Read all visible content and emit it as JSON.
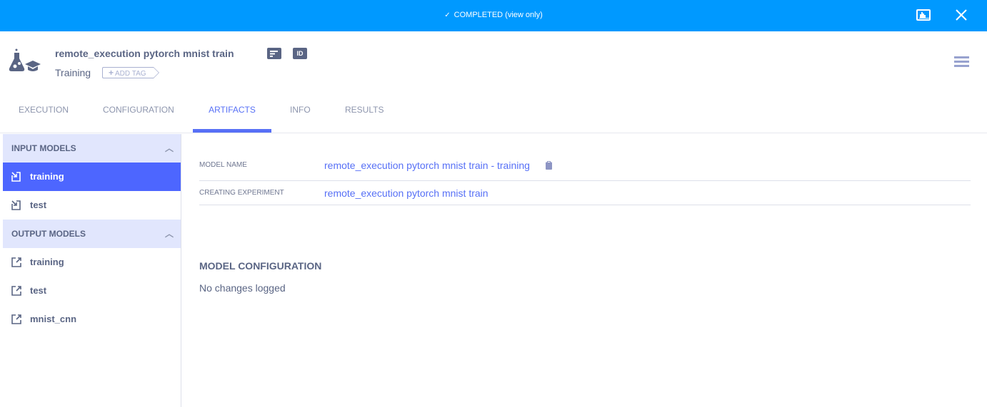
{
  "topbar": {
    "status_icon": "check-icon",
    "status_text": "COMPLETED (view only)",
    "chart_icon": "chart-icon",
    "close_icon": "close-icon",
    "color": "#0099ff"
  },
  "header": {
    "title": "remote_execution pytorch mnist train",
    "type": "Training",
    "add_tag_label": "ADD TAG",
    "id_label": "ID",
    "experiment_icon": "flask-training-icon",
    "details_icon": "details-icon",
    "menu_icon": "hamburger-menu-icon"
  },
  "tabs": [
    {
      "label": "EXECUTION",
      "active": false
    },
    {
      "label": "CONFIGURATION",
      "active": false
    },
    {
      "label": "ARTIFACTS",
      "active": true
    },
    {
      "label": "INFO",
      "active": false
    },
    {
      "label": "RESULTS",
      "active": false
    }
  ],
  "sidebar": {
    "sections": [
      {
        "title": "INPUT MODELS",
        "items": [
          {
            "label": "training",
            "selected": true,
            "icon": "input-model-icon"
          },
          {
            "label": "test",
            "selected": false,
            "icon": "input-model-icon"
          }
        ]
      },
      {
        "title": "OUTPUT MODELS",
        "items": [
          {
            "label": "training",
            "selected": false,
            "icon": "output-model-icon"
          },
          {
            "label": "test",
            "selected": false,
            "icon": "output-model-icon"
          },
          {
            "label": "mnist_cnn",
            "selected": false,
            "icon": "output-model-icon"
          }
        ]
      }
    ]
  },
  "main": {
    "model_name_label": "MODEL NAME",
    "model_name_value": "remote_execution pytorch mnist train - training",
    "creating_experiment_label": "CREATING EXPERIMENT",
    "creating_experiment_value": "remote_execution pytorch mnist train",
    "model_configuration_title": "MODEL CONFIGURATION",
    "model_configuration_text": "No changes logged"
  },
  "colors": {
    "accent": "#5770f6",
    "selected": "#4d66ff",
    "section_bg": "#e1e6fd",
    "text": "#5a6584"
  }
}
